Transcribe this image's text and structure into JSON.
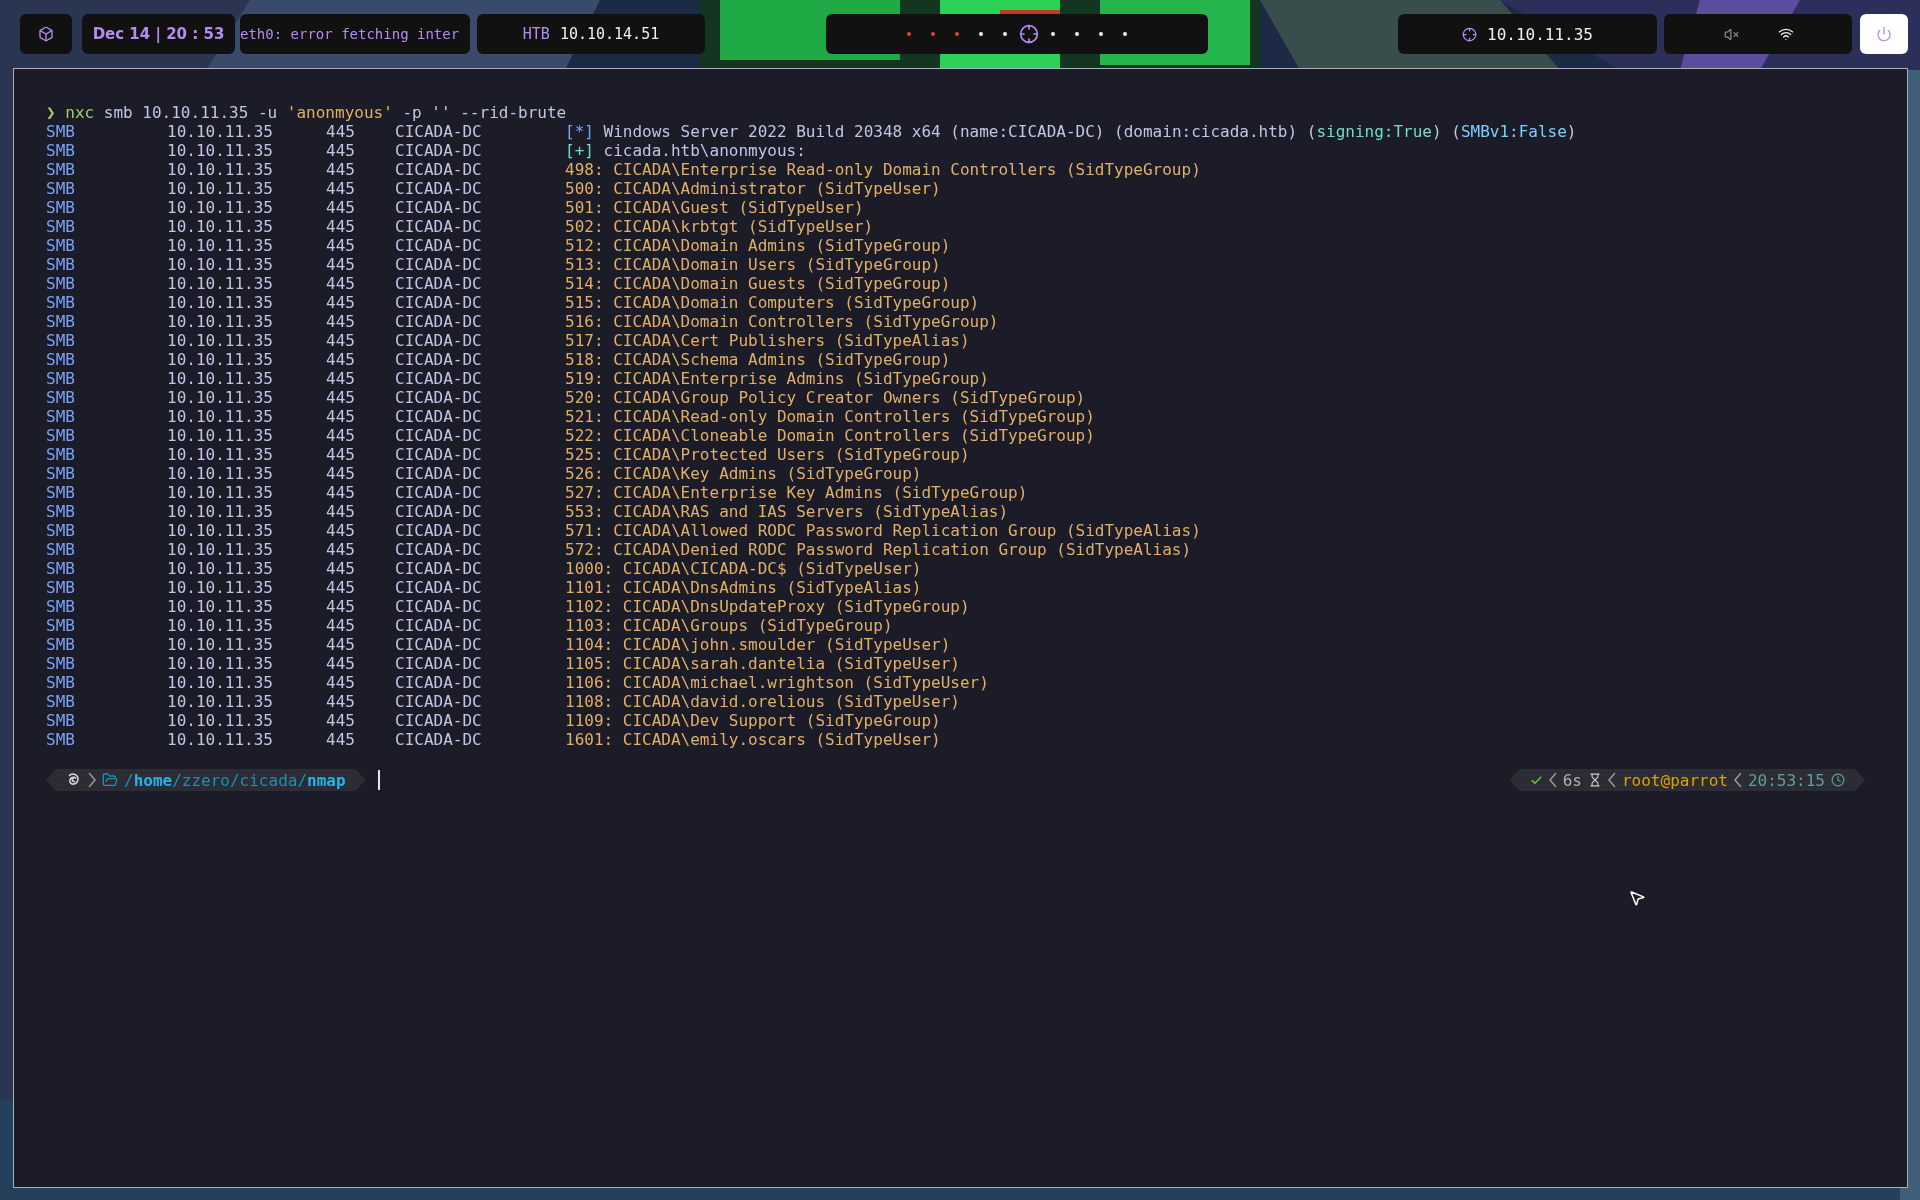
{
  "top_bar": {
    "clock": "Dec 14 | 20 : 53",
    "network_status": "eth0: error fetching inter",
    "vpn": {
      "label": "HTB",
      "ip": "10.10.14.51"
    },
    "workspaces": [
      {
        "selected": false,
        "color": "#e0423c"
      },
      {
        "selected": false,
        "color": "#e0423c"
      },
      {
        "selected": false,
        "color": "#e0423c"
      },
      {
        "selected": false,
        "color": "#f2f2f2"
      },
      {
        "selected": false,
        "color": "#f2f2f2"
      },
      {
        "selected": true,
        "color": "#b58cf0"
      },
      {
        "selected": false,
        "color": "#f2f2f2"
      },
      {
        "selected": false,
        "color": "#f2f2f2"
      },
      {
        "selected": false,
        "color": "#f2f2f2"
      },
      {
        "selected": false,
        "color": "#f2f2f2"
      }
    ],
    "target": "10.10.11.35",
    "muted": true
  },
  "terminal": {
    "command": [
      {
        "text": "❯ ",
        "kind": "prompt"
      },
      {
        "text": "nxc",
        "kind": "prompt"
      },
      {
        "text": " smb 10.10.11.35 -u ",
        "kind": "plain"
      },
      {
        "text": "'anonmyous'",
        "kind": "string"
      },
      {
        "text": " -p '' --rid-brute",
        "kind": "plain"
      }
    ],
    "rows": [
      {
        "protocol": "SMB",
        "host": "10.10.11.35",
        "port": "445",
        "name": "CICADA-DC",
        "message": [
          {
            "text": "[*]",
            "kind": "info"
          },
          {
            "text": " Windows Server 2022 Build 20348 x64 (name:CICADA-DC) (domain:cicada.htb) (",
            "kind": "plain"
          },
          {
            "text": "signing:True",
            "kind": "good"
          },
          {
            "text": ") (",
            "kind": "plain"
          },
          {
            "text": "SMBv1:False",
            "kind": "cyan"
          },
          {
            "text": ")",
            "kind": "plain"
          }
        ]
      },
      {
        "protocol": "SMB",
        "host": "10.10.11.35",
        "port": "445",
        "name": "CICADA-DC",
        "message": [
          {
            "text": "[+]",
            "kind": "good"
          },
          {
            "text": " cicada.htb\\anonmyous:",
            "kind": "plain"
          }
        ]
      },
      {
        "protocol": "SMB",
        "host": "10.10.11.35",
        "port": "445",
        "name": "CICADA-DC",
        "message": [
          {
            "text": "498: CICADA\\Enterprise Read-only Domain Controllers (SidTypeGroup)",
            "kind": "entry"
          }
        ]
      },
      {
        "protocol": "SMB",
        "host": "10.10.11.35",
        "port": "445",
        "name": "CICADA-DC",
        "message": [
          {
            "text": "500: CICADA\\Administrator (SidTypeUser)",
            "kind": "entry"
          }
        ]
      },
      {
        "protocol": "SMB",
        "host": "10.10.11.35",
        "port": "445",
        "name": "CICADA-DC",
        "message": [
          {
            "text": "501: CICADA\\Guest (SidTypeUser)",
            "kind": "entry"
          }
        ]
      },
      {
        "protocol": "SMB",
        "host": "10.10.11.35",
        "port": "445",
        "name": "CICADA-DC",
        "message": [
          {
            "text": "502: CICADA\\krbtgt (SidTypeUser)",
            "kind": "entry"
          }
        ]
      },
      {
        "protocol": "SMB",
        "host": "10.10.11.35",
        "port": "445",
        "name": "CICADA-DC",
        "message": [
          {
            "text": "512: CICADA\\Domain Admins (SidTypeGroup)",
            "kind": "entry"
          }
        ]
      },
      {
        "protocol": "SMB",
        "host": "10.10.11.35",
        "port": "445",
        "name": "CICADA-DC",
        "message": [
          {
            "text": "513: CICADA\\Domain Users (SidTypeGroup)",
            "kind": "entry"
          }
        ]
      },
      {
        "protocol": "SMB",
        "host": "10.10.11.35",
        "port": "445",
        "name": "CICADA-DC",
        "message": [
          {
            "text": "514: CICADA\\Domain Guests (SidTypeGroup)",
            "kind": "entry"
          }
        ]
      },
      {
        "protocol": "SMB",
        "host": "10.10.11.35",
        "port": "445",
        "name": "CICADA-DC",
        "message": [
          {
            "text": "515: CICADA\\Domain Computers (SidTypeGroup)",
            "kind": "entry"
          }
        ]
      },
      {
        "protocol": "SMB",
        "host": "10.10.11.35",
        "port": "445",
        "name": "CICADA-DC",
        "message": [
          {
            "text": "516: CICADA\\Domain Controllers (SidTypeGroup)",
            "kind": "entry"
          }
        ]
      },
      {
        "protocol": "SMB",
        "host": "10.10.11.35",
        "port": "445",
        "name": "CICADA-DC",
        "message": [
          {
            "text": "517: CICADA\\Cert Publishers (SidTypeAlias)",
            "kind": "entry"
          }
        ]
      },
      {
        "protocol": "SMB",
        "host": "10.10.11.35",
        "port": "445",
        "name": "CICADA-DC",
        "message": [
          {
            "text": "518: CICADA\\Schema Admins (SidTypeGroup)",
            "kind": "entry"
          }
        ]
      },
      {
        "protocol": "SMB",
        "host": "10.10.11.35",
        "port": "445",
        "name": "CICADA-DC",
        "message": [
          {
            "text": "519: CICADA\\Enterprise Admins (SidTypeGroup)",
            "kind": "entry"
          }
        ]
      },
      {
        "protocol": "SMB",
        "host": "10.10.11.35",
        "port": "445",
        "name": "CICADA-DC",
        "message": [
          {
            "text": "520: CICADA\\Group Policy Creator Owners (SidTypeGroup)",
            "kind": "entry"
          }
        ]
      },
      {
        "protocol": "SMB",
        "host": "10.10.11.35",
        "port": "445",
        "name": "CICADA-DC",
        "message": [
          {
            "text": "521: CICADA\\Read-only Domain Controllers (SidTypeGroup)",
            "kind": "entry"
          }
        ]
      },
      {
        "protocol": "SMB",
        "host": "10.10.11.35",
        "port": "445",
        "name": "CICADA-DC",
        "message": [
          {
            "text": "522: CICADA\\Cloneable Domain Controllers (SidTypeGroup)",
            "kind": "entry"
          }
        ]
      },
      {
        "protocol": "SMB",
        "host": "10.10.11.35",
        "port": "445",
        "name": "CICADA-DC",
        "message": [
          {
            "text": "525: CICADA\\Protected Users (SidTypeGroup)",
            "kind": "entry"
          }
        ]
      },
      {
        "protocol": "SMB",
        "host": "10.10.11.35",
        "port": "445",
        "name": "CICADA-DC",
        "message": [
          {
            "text": "526: CICADA\\Key Admins (SidTypeGroup)",
            "kind": "entry"
          }
        ]
      },
      {
        "protocol": "SMB",
        "host": "10.10.11.35",
        "port": "445",
        "name": "CICADA-DC",
        "message": [
          {
            "text": "527: CICADA\\Enterprise Key Admins (SidTypeGroup)",
            "kind": "entry"
          }
        ]
      },
      {
        "protocol": "SMB",
        "host": "10.10.11.35",
        "port": "445",
        "name": "CICADA-DC",
        "message": [
          {
            "text": "553: CICADA\\RAS and IAS Servers (SidTypeAlias)",
            "kind": "entry"
          }
        ]
      },
      {
        "protocol": "SMB",
        "host": "10.10.11.35",
        "port": "445",
        "name": "CICADA-DC",
        "message": [
          {
            "text": "571: CICADA\\Allowed RODC Password Replication Group (SidTypeAlias)",
            "kind": "entry"
          }
        ]
      },
      {
        "protocol": "SMB",
        "host": "10.10.11.35",
        "port": "445",
        "name": "CICADA-DC",
        "message": [
          {
            "text": "572: CICADA\\Denied RODC Password Replication Group (SidTypeAlias)",
            "kind": "entry"
          }
        ]
      },
      {
        "protocol": "SMB",
        "host": "10.10.11.35",
        "port": "445",
        "name": "CICADA-DC",
        "message": [
          {
            "text": "1000: CICADA\\CICADA-DC$ (SidTypeUser)",
            "kind": "entry"
          }
        ]
      },
      {
        "protocol": "SMB",
        "host": "10.10.11.35",
        "port": "445",
        "name": "CICADA-DC",
        "message": [
          {
            "text": "1101: CICADA\\DnsAdmins (SidTypeAlias)",
            "kind": "entry"
          }
        ]
      },
      {
        "protocol": "SMB",
        "host": "10.10.11.35",
        "port": "445",
        "name": "CICADA-DC",
        "message": [
          {
            "text": "1102: CICADA\\DnsUpdateProxy (SidTypeGroup)",
            "kind": "entry"
          }
        ]
      },
      {
        "protocol": "SMB",
        "host": "10.10.11.35",
        "port": "445",
        "name": "CICADA-DC",
        "message": [
          {
            "text": "1103: CICADA\\Groups (SidTypeGroup)",
            "kind": "entry"
          }
        ]
      },
      {
        "protocol": "SMB",
        "host": "10.10.11.35",
        "port": "445",
        "name": "CICADA-DC",
        "message": [
          {
            "text": "1104: CICADA\\john.smoulder (SidTypeUser)",
            "kind": "entry"
          }
        ]
      },
      {
        "protocol": "SMB",
        "host": "10.10.11.35",
        "port": "445",
        "name": "CICADA-DC",
        "message": [
          {
            "text": "1105: CICADA\\sarah.dantelia (SidTypeUser)",
            "kind": "entry"
          }
        ]
      },
      {
        "protocol": "SMB",
        "host": "10.10.11.35",
        "port": "445",
        "name": "CICADA-DC",
        "message": [
          {
            "text": "1106: CICADA\\michael.wrightson (SidTypeUser)",
            "kind": "entry"
          }
        ]
      },
      {
        "protocol": "SMB",
        "host": "10.10.11.35",
        "port": "445",
        "name": "CICADA-DC",
        "message": [
          {
            "text": "1108: CICADA\\david.orelious (SidTypeUser)",
            "kind": "entry"
          }
        ]
      },
      {
        "protocol": "SMB",
        "host": "10.10.11.35",
        "port": "445",
        "name": "CICADA-DC",
        "message": [
          {
            "text": "1109: CICADA\\Dev Support (SidTypeGroup)",
            "kind": "entry"
          }
        ]
      },
      {
        "protocol": "SMB",
        "host": "10.10.11.35",
        "port": "445",
        "name": "CICADA-DC",
        "message": [
          {
            "text": "1601: CICADA\\emily.oscars (SidTypeUser)",
            "kind": "entry"
          }
        ]
      }
    ],
    "prompt": {
      "path": [
        {
          "text": "/",
          "kind": "dim"
        },
        {
          "text": "home",
          "kind": "bold"
        },
        {
          "text": "/zzero/cicada/",
          "kind": "dim"
        },
        {
          "text": "nmap",
          "kind": "bold"
        }
      ],
      "status_ok": true,
      "duration": "6s",
      "user": "root@parrot",
      "time": "20:53:15"
    }
  }
}
